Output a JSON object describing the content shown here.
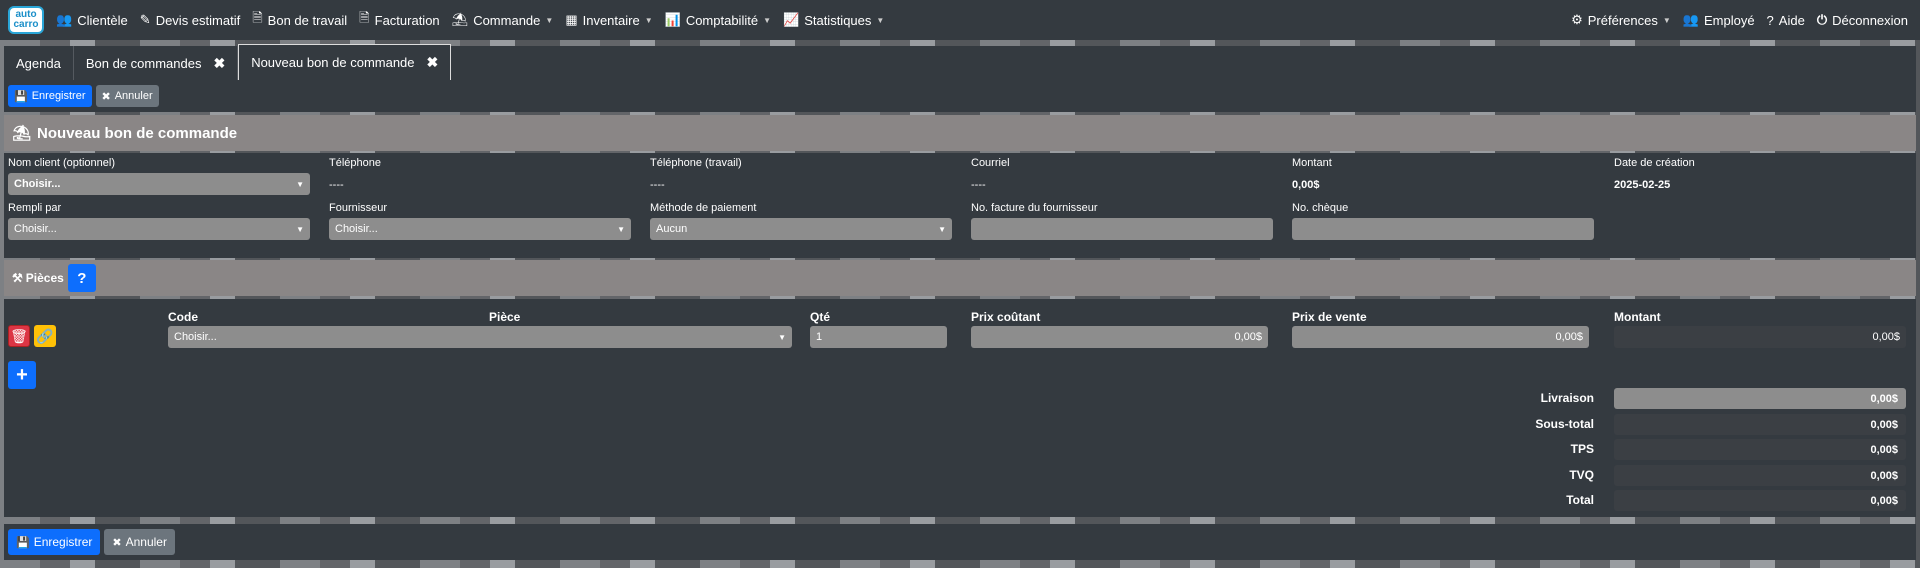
{
  "app": {
    "logo_top": "auto",
    "logo_bottom": "carro"
  },
  "nav": {
    "items": [
      {
        "label": "Clientèle",
        "icon": "users-icon"
      },
      {
        "label": "Devis estimatif",
        "icon": "edit-icon"
      },
      {
        "label": "Bon de travail",
        "icon": "file-icon"
      },
      {
        "label": "Facturation",
        "icon": "file-icon"
      },
      {
        "label": "Commande",
        "icon": "basket-icon"
      },
      {
        "label": "Inventaire",
        "icon": "grid-icon"
      },
      {
        "label": "Comptabilité",
        "icon": "chart-icon"
      },
      {
        "label": "Statistiques",
        "icon": "bar-chart-icon"
      }
    ],
    "right": {
      "preferences": "Préférences",
      "employee": "Employé",
      "help": "Aide",
      "logout": "Déconnexion"
    }
  },
  "tabs": [
    {
      "label": "Agenda"
    },
    {
      "label": "Bon de commandes"
    },
    {
      "label": "Nouveau bon de commande"
    }
  ],
  "toolbar": {
    "save": "Enregistrer",
    "cancel": "Annuler"
  },
  "header": {
    "title": "Nouveau bon de commande"
  },
  "form": {
    "client_label": "Nom client (optionnel)",
    "client_value": "Choisir...",
    "phone_label": "Téléphone",
    "phone_value": "----",
    "work_phone_label": "Téléphone (travail)",
    "work_phone_value": "----",
    "email_label": "Courriel",
    "email_value": "----",
    "amount_label": "Montant",
    "amount_value": "0,00$",
    "date_label": "Date de création",
    "date_value": "2025-02-25",
    "filled_by_label": "Rempli par",
    "filled_by_value": "Choisir...",
    "supplier_label": "Fournisseur",
    "supplier_value": "Choisir...",
    "payment_label": "Méthode de paiement",
    "payment_value": "Aucun",
    "supplier_invoice_label": "No. facture du fournisseur",
    "cheque_label": "No. chèque"
  },
  "parts": {
    "title": "Pièces",
    "help": "?",
    "columns": {
      "code": "Code",
      "piece": "Pièce",
      "qty": "Qté",
      "cost": "Prix coûtant",
      "sale": "Prix de vente",
      "amount": "Montant"
    },
    "row": {
      "piece": "Choisir...",
      "qty": "1",
      "cost": "0,00$",
      "sale": "0,00$",
      "amount": "0,00$"
    },
    "add": "+"
  },
  "totals": {
    "delivery_label": "Livraison",
    "delivery": "0,00$",
    "subtotal_label": "Sous-total",
    "subtotal": "0,00$",
    "tps_label": "TPS",
    "tps": "0,00$",
    "tvq_label": "TVQ",
    "tvq": "0,00$",
    "total_label": "Total",
    "total": "0,00$"
  },
  "colors": {
    "primary": "#0d6efd",
    "danger": "#dc3545",
    "warning": "#ffc107",
    "panel": "#343a40",
    "header": "#8a8686"
  }
}
